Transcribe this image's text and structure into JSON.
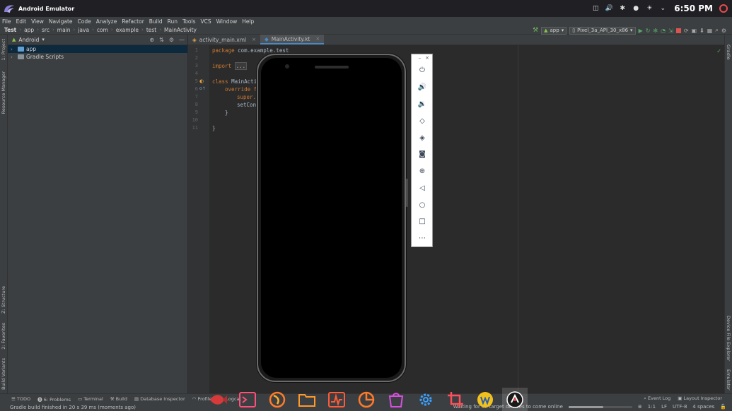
{
  "window": {
    "title": "Android Emulator"
  },
  "tray": {
    "clock": "6:50 PM"
  },
  "menu": [
    "File",
    "Edit",
    "View",
    "Navigate",
    "Code",
    "Analyze",
    "Refactor",
    "Build",
    "Run",
    "Tools",
    "VCS",
    "Window",
    "Help"
  ],
  "breadcrumb": [
    "Test",
    "app",
    "src",
    "main",
    "java",
    "com",
    "example",
    "test",
    "MainActivity"
  ],
  "run_config": {
    "module": "app",
    "device": "Pixel_3a_API_30_x86"
  },
  "project_panel": {
    "view_mode": "Android",
    "items": [
      {
        "label": "app",
        "selected": true
      },
      {
        "label": "Gradle Scripts",
        "selected": false
      }
    ]
  },
  "left_tabs": [
    "1: Project",
    "Resource Manager",
    "Z: Structure",
    "2: Favorites",
    "Build Variants"
  ],
  "right_tabs": [
    "Gradle",
    "Device File Explorer",
    "Emulator"
  ],
  "editor": {
    "tabs": [
      {
        "label": "activity_main.xml",
        "active": false
      },
      {
        "label": "MainActivity.kt",
        "active": true
      }
    ],
    "line_numbers": [
      "1",
      "2",
      "3",
      "4",
      "5",
      "6",
      "7",
      "8",
      "9",
      "10",
      "11"
    ],
    "code": {
      "l1_kw": "package",
      "l1_tx": " com.example.test",
      "l3_kw": "import",
      "l3_fold": "...",
      "l5_kw": "class",
      "l5_tx": " MainActi",
      "l6_kw": "override f",
      "l7_kw": "super.",
      "l8_tx": "setCon",
      "l9_tx": "}",
      "l11_tx": "}"
    }
  },
  "emulator_controls": [
    "power",
    "volume-up",
    "volume-down",
    "rotate-left",
    "rotate-right",
    "screenshot",
    "zoom",
    "back",
    "home",
    "overview",
    "more"
  ],
  "bottom_tools": [
    "TODO",
    "6: Problems",
    "Terminal",
    "Build",
    "Database Inspector",
    "Profiler",
    "Logcat"
  ],
  "bottom_tools_right": [
    "Event Log",
    "Layout Inspector"
  ],
  "status": {
    "message": "Gradle build finished in 20 s 39 ms (moments ago)",
    "progress_message": "Waiting for all target devices to come online",
    "position": "1:1",
    "line_sep": "LF",
    "encoding": "UTF-8",
    "indent": "4 spaces",
    "progress": 0.55
  },
  "colors": {
    "accent": "#4a88c7",
    "keyword": "#cc7832",
    "text": "#a9b7c6"
  }
}
